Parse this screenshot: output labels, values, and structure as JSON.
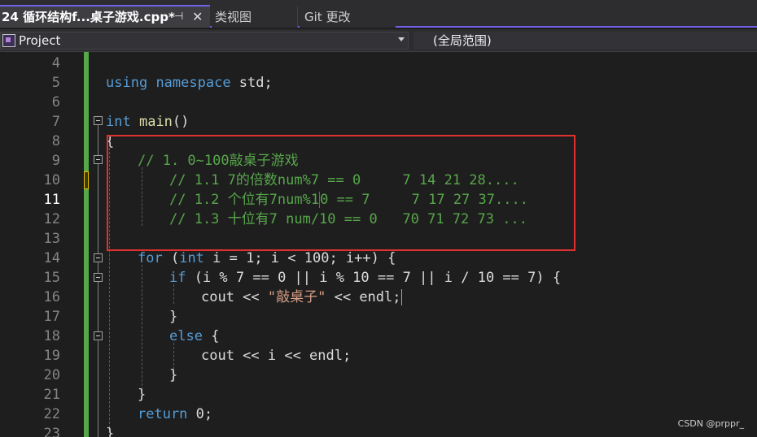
{
  "tabs": [
    {
      "label": "24 循环结构f...桌子游戏.cpp*",
      "pin_icon": "pin-icon",
      "close_icon": "close-icon",
      "active": true
    },
    {
      "label": "类视图",
      "active": false
    },
    {
      "label": "Git 更改",
      "active": false
    }
  ],
  "navbar": {
    "project": "Project",
    "scope": "(全局范围)"
  },
  "editor": {
    "line_numbers": [
      "4",
      "5",
      "6",
      "7",
      "8",
      "9",
      "10",
      "11",
      "12",
      "13",
      "14",
      "15",
      "16",
      "17",
      "18",
      "19",
      "20",
      "21",
      "22",
      "23"
    ],
    "current_line": "11",
    "lines": {
      "l5": {
        "kw1": "using",
        "kw2": "namespace",
        "rest": " std;"
      },
      "l7": {
        "kw": "int",
        "fn": "main",
        "rest": "()"
      },
      "l8": {
        "text": "{"
      },
      "l9": {
        "comment": "// 1. 0~100敲桌子游戏"
      },
      "l10": {
        "comment": "// 1.1 7的倍数num%7 == 0     7 14 21 28...."
      },
      "l11a": {
        "comment": "// 1.2 个位有7num%1"
      },
      "l11b": {
        "comment": "0 == 7     7 17 27 37...."
      },
      "l12": {
        "comment": "// 1.3 十位有7 num/10 == 0   70 71 72 73 ..."
      },
      "l14": {
        "kw1": "for",
        "p1": " (",
        "kw2": "int",
        "rest": " i = 1; i < 100; i++) {"
      },
      "l15": {
        "kw": "if",
        "rest": " (i % 7 == 0 || i % 10 == 7 || i / 10 == 7) {"
      },
      "l16": {
        "pre": "cout << ",
        "str": "\"敲桌子\"",
        "post": " << endl;"
      },
      "l17": {
        "text": "}"
      },
      "l18": {
        "kw": "else",
        "rest": " {"
      },
      "l19": {
        "text": "cout << i << endl;"
      },
      "l20": {
        "text": "}"
      },
      "l21": {
        "text": "}"
      },
      "l22": {
        "kw": "return",
        "rest": " 0;"
      },
      "l23": {
        "text": "}"
      }
    }
  },
  "watermark": "CSDN @prppr_",
  "colors": {
    "accent": "#7160e8",
    "keyword": "#569cd6",
    "comment": "#57a64a",
    "string": "#d69d85",
    "highlight_box": "#e0312f"
  }
}
